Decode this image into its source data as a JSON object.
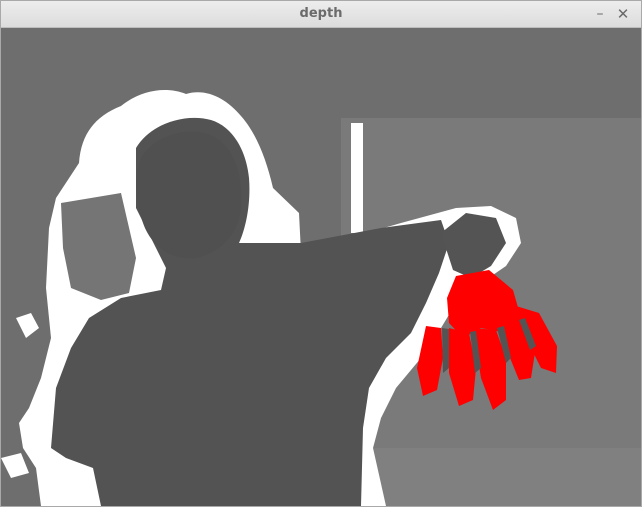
{
  "window": {
    "title": "depth",
    "minimize_glyph": "–",
    "close_glyph": "✕"
  },
  "icons": {
    "minimize": "minimize-icon",
    "close": "close-icon"
  },
  "colors": {
    "background_depth": "#6d6d6d",
    "wall_depth": "#7b7b7b",
    "person_depth": "#525252",
    "invalid_depth": "#ffffff",
    "hand_highlight": "#ff0000"
  }
}
